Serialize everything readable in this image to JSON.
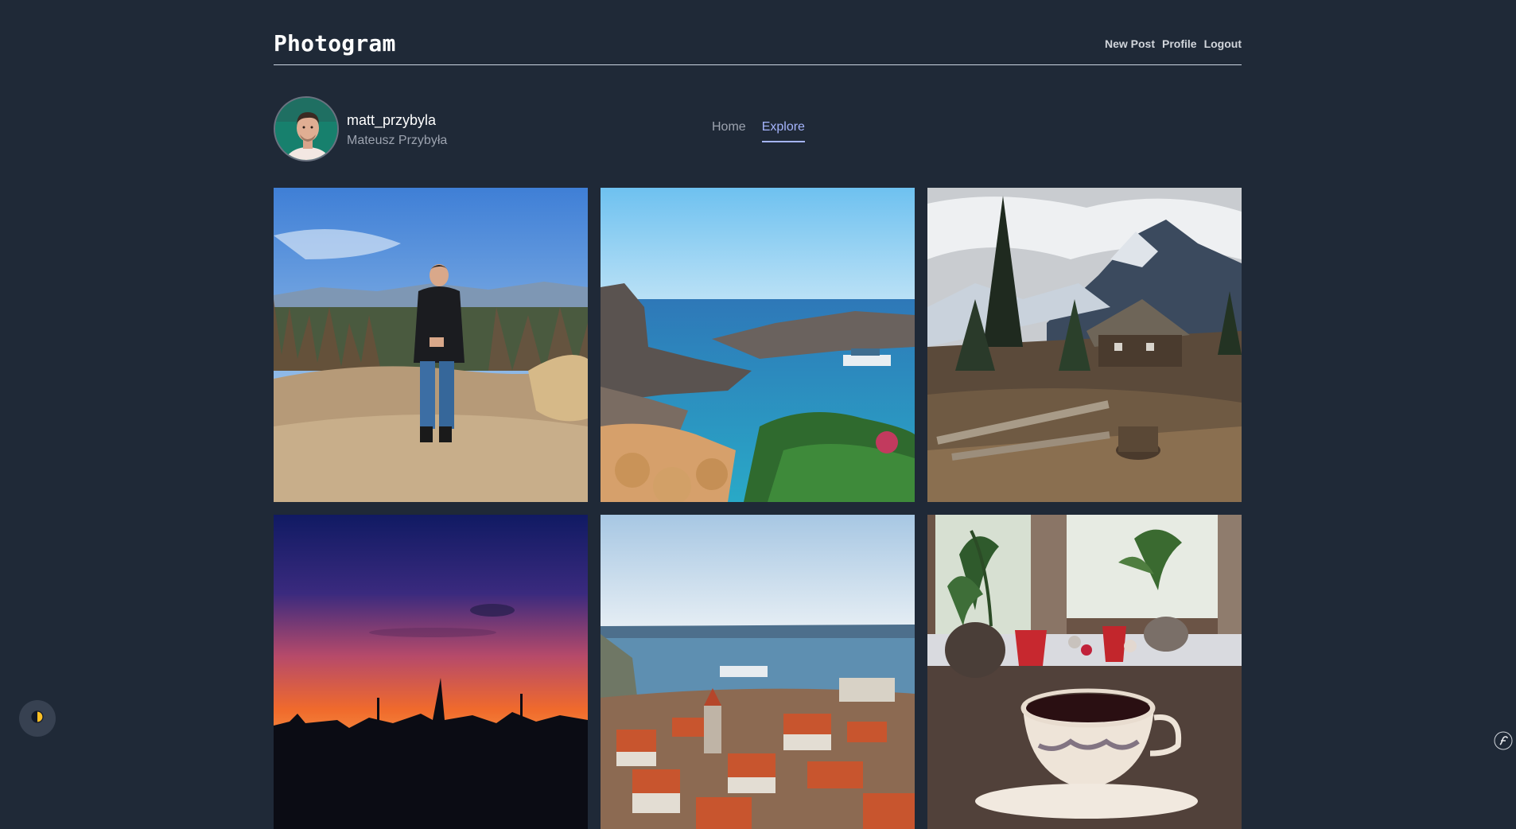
{
  "header": {
    "brand": "Photogram",
    "nav": [
      {
        "label": "New Post"
      },
      {
        "label": "Profile"
      },
      {
        "label": "Logout"
      }
    ]
  },
  "profile": {
    "username": "matt_przybyla",
    "full_name": "Mateusz Przybyła"
  },
  "tabs": [
    {
      "label": "Home",
      "active": false
    },
    {
      "label": "Explore",
      "active": true
    }
  ],
  "posts": [
    {
      "subject": "man-on-mountain-trail"
    },
    {
      "subject": "sea-cove-with-boat"
    },
    {
      "subject": "mountain-hut-in-forest"
    },
    {
      "subject": "sunset-over-city-skyline"
    },
    {
      "subject": "coastal-town-view"
    },
    {
      "subject": "teacup-by-window-with-plants"
    }
  ],
  "colors": {
    "background": "#1f2937",
    "accent": "#a5b4fc"
  },
  "icons": {
    "theme_toggle": "half-moon-icon",
    "debug_toolbar": "symfony-icon"
  }
}
